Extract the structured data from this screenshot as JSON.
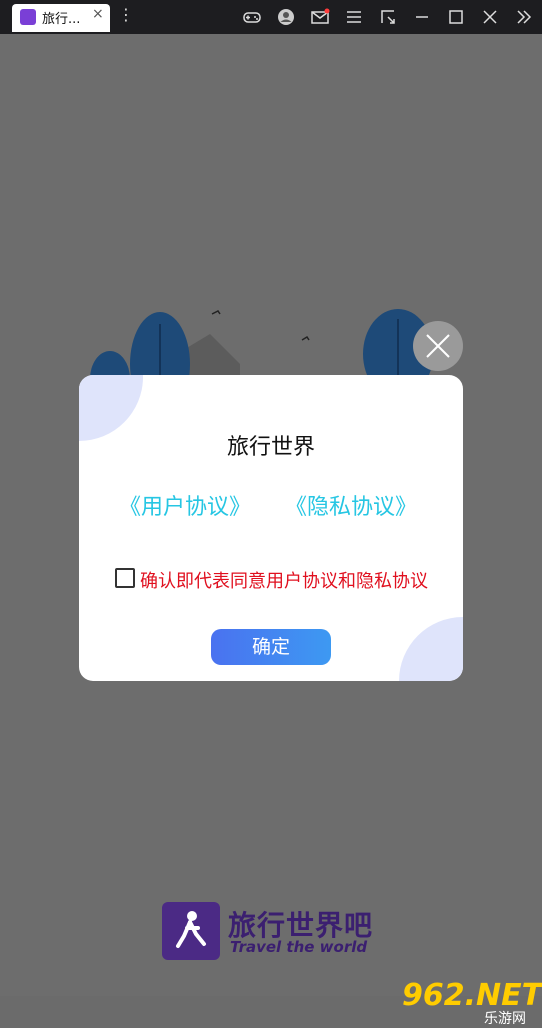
{
  "window": {
    "tab_title": "旅行...",
    "tab_close": "×",
    "tab_menu": "⋮",
    "toolbar_icons": [
      "gamepad-icon",
      "user-icon",
      "mail-icon",
      "menu-icon",
      "crop-icon",
      "minimize-icon",
      "maximize-icon",
      "close-icon",
      "expand-icon"
    ]
  },
  "dialog": {
    "title": "旅行世界",
    "user_agreement_link": "《用户协议》",
    "privacy_link": "《隐私协议》",
    "agree_text": "确认即代表同意用户协议和隐私协议",
    "agree_checked": false,
    "confirm_label": "确定"
  },
  "brand": {
    "name_cn": "旅行世界吧",
    "name_en": "Travel the world"
  },
  "watermark": {
    "number": "962.NET",
    "site_cn": "乐游网"
  },
  "colors": {
    "link": "#26c6e3",
    "agree_text": "#e0101f",
    "button_start": "#4a72f0",
    "button_end": "#3d99f2",
    "overlay": "#6d6d6d",
    "titlebar": "#1d1d20"
  }
}
